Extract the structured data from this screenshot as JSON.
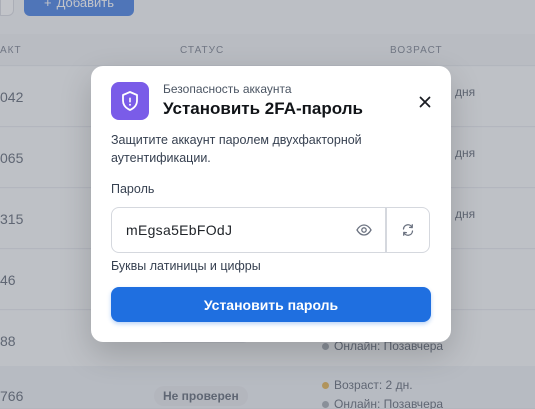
{
  "toolbar": {
    "add_label": "Добавить",
    "add_icon": "plus-icon"
  },
  "table": {
    "headers": [
      "АКТ",
      "СТАТУС",
      "ВОЗРАСТ"
    ],
    "rows": [
      {
        "num": "042",
        "age": "дня"
      },
      {
        "num": "065",
        "age": "дня"
      },
      {
        "num": "315",
        "age": "дня"
      },
      {
        "num": "46",
        "age": ""
      },
      {
        "num": "88",
        "age": ""
      },
      {
        "num": "766",
        "age": ""
      }
    ],
    "row5_online": "Онлайн: Позавчера",
    "row6_badge": "Не проверен",
    "row6_age": "Возраст: 2 дн.",
    "row6_online": "Онлайн: Позавчера"
  },
  "modal": {
    "icon": "shield-icon",
    "subtitle": "Безопасность аккаунта",
    "title": "Установить 2FA-пароль",
    "description": "Защитите аккаунт паролем двухфакторной аутентификации.",
    "password_label": "Пароль",
    "password_value": "mEgsa5EbFOdJ",
    "hint": "Буквы латиницы и цифры",
    "submit_label": "Установить пароль",
    "colors": {
      "accent": "#1f6fe0",
      "icon_bg": "#7a5ce8"
    }
  }
}
